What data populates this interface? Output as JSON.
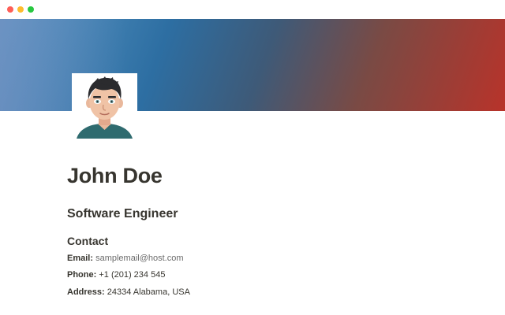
{
  "window": {
    "controls": [
      "close",
      "minimize",
      "zoom"
    ]
  },
  "profile": {
    "name": "John Doe",
    "role": "Software Engineer",
    "avatar_icon": "cartoon-man-avatar"
  },
  "contact": {
    "heading": "Contact",
    "email_label": "Email:",
    "email_value": "samplemail@host.com",
    "phone_label": "Phone:",
    "phone_value": "+1 (201) 234 545",
    "address_label": "Address:",
    "address_value": "24334 Alabama, USA"
  },
  "colors": {
    "cover_left": "#5e9bc8",
    "cover_mid": "#2d6ea2",
    "cover_right": "#b8332a",
    "text": "#37352f",
    "muted": "#6b6b6b"
  }
}
